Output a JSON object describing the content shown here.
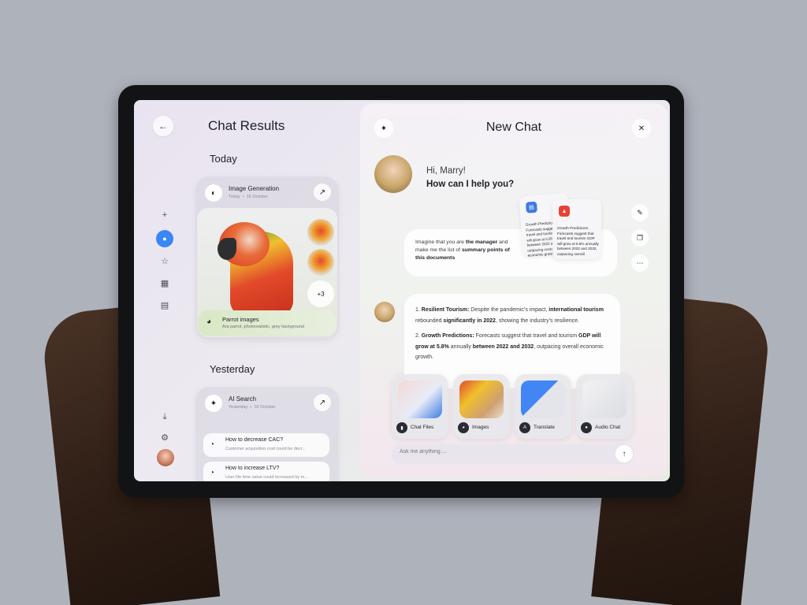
{
  "sidebar": {
    "back_icon": "←",
    "items": [
      {
        "icon": "plus-icon",
        "glyph": "+"
      },
      {
        "icon": "chat-bubble-icon",
        "glyph": "●"
      },
      {
        "icon": "star-icon",
        "glyph": "☆"
      },
      {
        "icon": "calendar-icon",
        "glyph": "▦"
      },
      {
        "icon": "document-icon",
        "glyph": "▤"
      }
    ],
    "bottom": [
      {
        "icon": "download-icon",
        "glyph": "⤓"
      },
      {
        "icon": "settings-icon",
        "glyph": "⚙"
      }
    ],
    "active_color": "#3a86f5"
  },
  "results": {
    "title": "Chat Results",
    "today_label": "Today",
    "yesterday_label": "Yesterday",
    "image_card": {
      "title": "Image Generation",
      "date_today": "Today",
      "date_day": "16 October",
      "more_count": "+3",
      "caption_title": "Parrot images",
      "caption_sub": "Ara parrot, photorealistic, grey background"
    },
    "search_card": {
      "title": "AI Search",
      "date_yesterday": "Yesterday",
      "date_day": "16 October",
      "questions": [
        {
          "title": "How to decrease CAC?",
          "sub": "Customer acquisition cost could be decr..."
        },
        {
          "title": "How to increase LTV?",
          "sub": "User life time value could increased by m..."
        }
      ]
    }
  },
  "chat": {
    "title": "New Chat",
    "greeting": "Hi, Marry!",
    "question": "How can I help you?",
    "prompt_parts": [
      "Imagine that you are ",
      "the manager",
      " and make me the list of ",
      "summary points of this documents"
    ],
    "doc_text_1": "Growth Predictions: Forecasts suggest that travel and tourism GDP will grow at 5.8% annually between 2022 and 2032, outpacing overall economic growth.",
    "doc_text_2": "Growth Predictions: Forecasts suggest that travel and tourism GDP will grow at 5.8% annually between 2022 and 2032, outpacing overall",
    "answer": {
      "p1_label": "Resilient Tourism:",
      "p1_a": " Despite the pandemic's impact, ",
      "p1_b": "international tourism",
      "p1_c": " rebounded ",
      "p1_d": "significantly in 2022",
      "p1_e": ", showing the industry's resilience.",
      "p2_label": "Growth Predictions:",
      "p2_a": " Forecasts suggest that travel and tourism ",
      "p2_b": "GDP will grow at 5.8%",
      "p2_c": " annually ",
      "p2_d": "between 2022 and 2032",
      "p2_e": ", outpacing overall economic growth."
    },
    "tools": [
      {
        "label": "Chat Files",
        "icon": "files-icon"
      },
      {
        "label": "Images",
        "icon": "images-icon"
      },
      {
        "label": "Translate",
        "icon": "translate-icon"
      },
      {
        "label": "Audio Chat",
        "icon": "microphone-icon"
      }
    ],
    "input_placeholder": "Ask me anything ..."
  }
}
